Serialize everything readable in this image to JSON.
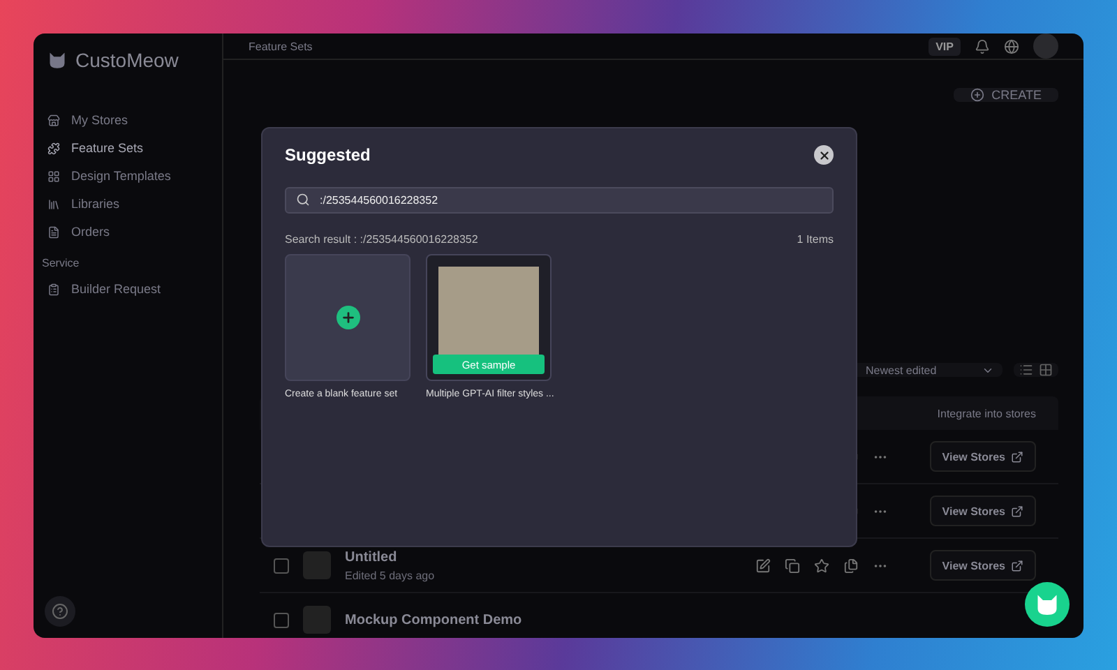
{
  "app": {
    "brand": "CustoMeow"
  },
  "sidebar": {
    "items": [
      {
        "label": "My Stores",
        "selected": false
      },
      {
        "label": "Feature Sets",
        "selected": true
      },
      {
        "label": "Design Templates",
        "selected": false
      },
      {
        "label": "Libraries",
        "selected": false
      },
      {
        "label": "Orders",
        "selected": false
      }
    ],
    "section": "Service",
    "service_items": [
      {
        "label": "Builder Request",
        "selected": false
      }
    ]
  },
  "header": {
    "breadcrumb": "Feature Sets",
    "badge": "VIP"
  },
  "toolbar": {
    "create": "CREATE",
    "sort": "Newest edited"
  },
  "table": {
    "column_header": "Integrate into stores",
    "rows": [
      {
        "action": "View Stores"
      },
      {
        "action": "View Stores"
      },
      {
        "title": "Untitled",
        "subtitle": "Edited 5 days ago",
        "checked": false,
        "action": "View Stores"
      },
      {
        "title": "Mockup Component Demo",
        "checked": false
      }
    ]
  },
  "modal": {
    "title": "Suggested",
    "search": {
      "value": ":/253544560016228352"
    },
    "result_label": "Search result : :/253544560016228352",
    "count": "1 Items",
    "cards": [
      {
        "kind": "blank",
        "caption": "Create a blank feature set"
      },
      {
        "kind": "template",
        "caption": "Multiple GPT-AI filter styles ...",
        "button": "Get sample"
      }
    ]
  }
}
